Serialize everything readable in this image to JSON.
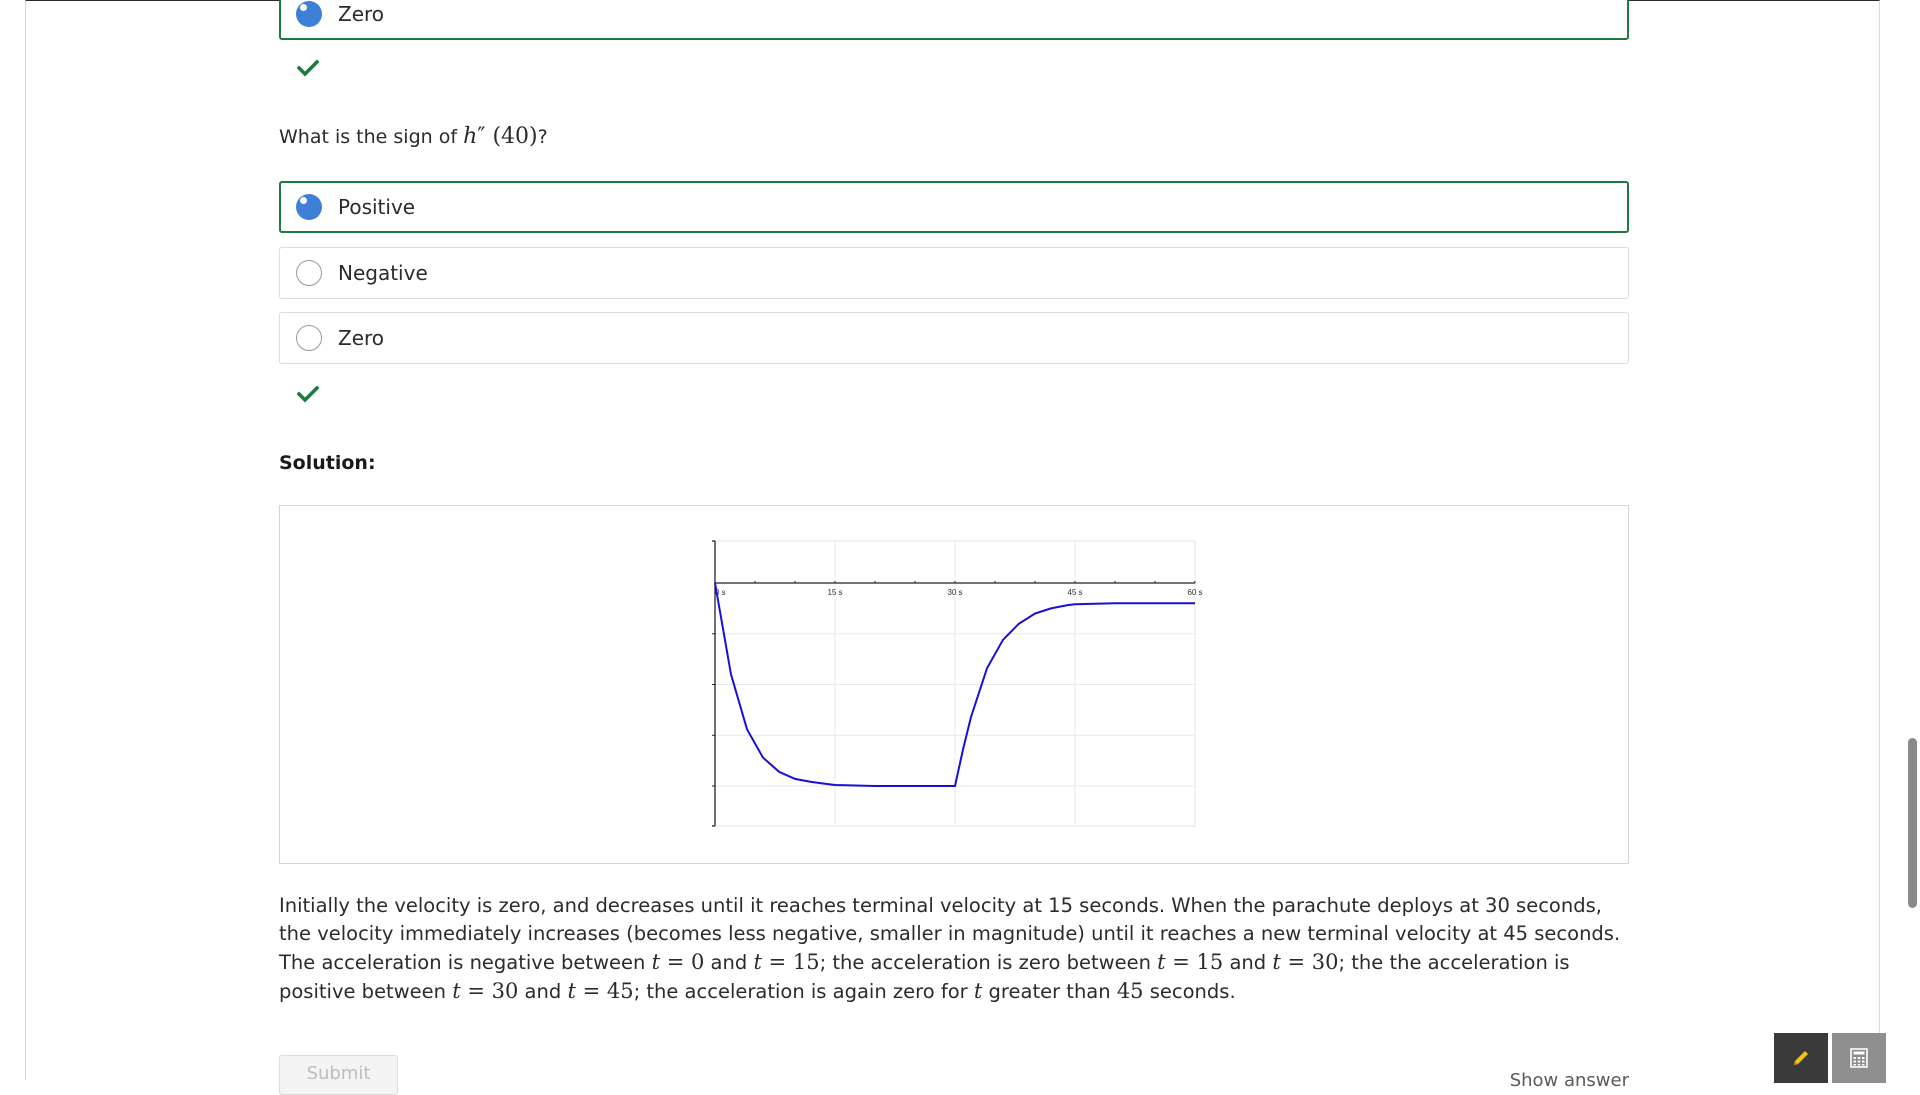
{
  "previous_question": {
    "selected_option_label": "Zero"
  },
  "question": {
    "prefix": "What is the sign of ",
    "math_func": "h",
    "math_prime": "″",
    "math_arg": "(40)",
    "suffix": "?"
  },
  "options": [
    {
      "label": "Positive",
      "selected": true
    },
    {
      "label": "Negative",
      "selected": false
    },
    {
      "label": "Zero",
      "selected": false
    }
  ],
  "solution": {
    "title": "Solution:",
    "explanation": {
      "s1": "Initially the velocity is zero, and decreases until it reaches terminal velocity at 15 seconds. When the parachute deploys at 30 seconds, the velocity immediately increases (becomes less negative, smaller in magnitude) until it reaches a new terminal velocity at 45 seconds. The acceleration is negative between ",
      "t": "t",
      "eq": " = ",
      "v0": "0",
      "and": " and ",
      "v15": "15",
      "s2": "; the acceleration is zero between ",
      "v30": "30",
      "s3": "; the the acceleration is positive between ",
      "v45": "45",
      "s4": "; the acceleration is again zero for ",
      "s5": " greater than ",
      "s6": " seconds."
    }
  },
  "chart_data": {
    "type": "line",
    "title": "",
    "xlabel": "",
    "ylabel": "",
    "x_ticks": [
      "0 s",
      "15 s",
      "30 s",
      "45 s",
      "60 s"
    ],
    "xlim": [
      0,
      60
    ],
    "grid": true,
    "series": [
      {
        "color": "#1a0fd6",
        "x": [
          0,
          2,
          4,
          6,
          8,
          10,
          12,
          14,
          15,
          20,
          25,
          30,
          31,
          32,
          34,
          36,
          38,
          40,
          42,
          44,
          45,
          50,
          55,
          60
        ],
        "y": [
          0,
          -0.45,
          -0.72,
          -0.86,
          -0.93,
          -0.965,
          -0.98,
          -0.99,
          -0.995,
          -1.0,
          -1.0,
          -1.0,
          -0.82,
          -0.66,
          -0.42,
          -0.28,
          -0.2,
          -0.15,
          -0.125,
          -0.11,
          -0.105,
          -0.1,
          -0.1,
          -0.1
        ]
      }
    ]
  },
  "buttons": {
    "submit_label": "Submit",
    "show_answer_label": "Show answer"
  },
  "colors": {
    "selected_border": "#1e7a3f",
    "radio_selected": "#3d80d8",
    "check": "#1e7a3f",
    "curve": "#1a0fd6",
    "tool_button": "#3a3a3a"
  },
  "icons": {
    "check": "checkmark-icon",
    "pencil": "pencil-icon",
    "calculator": "calculator-icon"
  }
}
